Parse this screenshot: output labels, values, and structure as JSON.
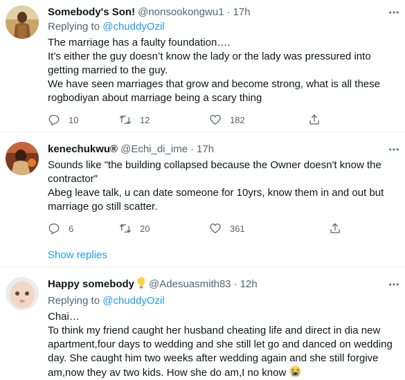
{
  "tweets": [
    {
      "name": "Somebody's Son!",
      "handle": "@nonsookongwu1",
      "sep": "·",
      "time": "17h",
      "replying_prefix": "Replying to",
      "replying_to": "@chuddyOzil",
      "lines": [
        "The marriage has a faulty foundation….",
        "It’s either the guy doesn’t know the lady or the lady was pressured into",
        "getting married to the guy.",
        "We have seen marriages that grow and become strong, what is all these",
        "rogbodiyan about marriage being a scary thing"
      ],
      "replies": "10",
      "retweets": "12",
      "likes": "182"
    },
    {
      "name": "kenechukwu®",
      "handle": "@Echi_di_ime",
      "sep": "·",
      "time": "17h",
      "lines": [
        "Sounds like \"the building collapsed because the Owner doesn't know the",
        "contractor\"",
        "Abeg leave talk, u can date someone for 10yrs, know them in and out but",
        "marriage go still scatter."
      ],
      "replies": "6",
      "retweets": "20",
      "likes": "361"
    },
    {
      "name": "Happy somebody",
      "handle": "@Adesuasmith83",
      "sep": "·",
      "time": "12h",
      "replying_prefix": "Replying to",
      "replying_to": "@chuddyOzil",
      "lines": [
        "Chai…",
        "To think my friend caught her husband cheating life and direct in dia new",
        "apartment,four days to wedding and she still let go and danced on wedding",
        "day. She caught him two weeks after wedding again and she still forgive",
        "am,now they av two kids. How she do am,I no know"
      ]
    }
  ],
  "show_replies": "Show replies",
  "colors": {
    "link": "#1d9bf0",
    "muted": "#536471",
    "text": "#0f1419",
    "divider": "#eff3f4"
  },
  "icons": {
    "name_badge": "light-bulb-icon",
    "trailing_emoji": "loudly-crying-face-icon"
  }
}
